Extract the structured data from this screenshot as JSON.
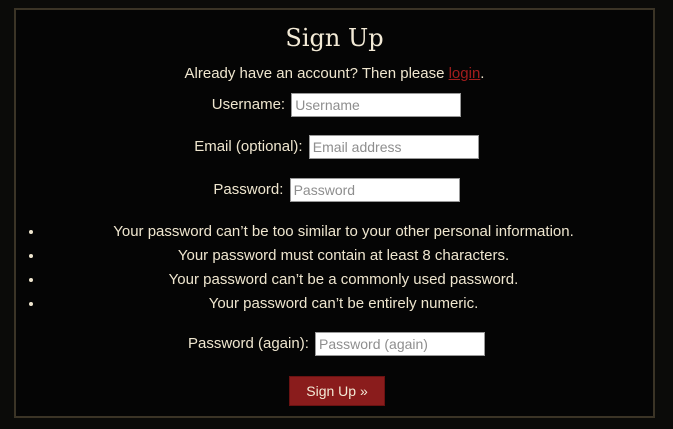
{
  "form": {
    "title": "Sign Up",
    "already_text": "Already have an account? Then please ",
    "login_label": "login",
    "period": ".",
    "fields": {
      "username": {
        "label": "Username:",
        "placeholder": "Username"
      },
      "email": {
        "label": "Email (optional):",
        "placeholder": "Email address"
      },
      "password": {
        "label": "Password:",
        "placeholder": "Password"
      },
      "password2": {
        "label": "Password (again):",
        "placeholder": "Password (again)"
      }
    },
    "password_help": [
      "Your password can’t be too similar to your other personal information.",
      "Your password must contain at least 8 characters.",
      "Your password can’t be a commonly used password.",
      "Your password can’t be entirely numeric."
    ],
    "submit_label": "Sign Up »"
  },
  "colors": {
    "background": "#050505",
    "text": "#efe6cf",
    "link": "#a11d1d",
    "button": "#8a1c1c",
    "border": "#3b3426"
  }
}
